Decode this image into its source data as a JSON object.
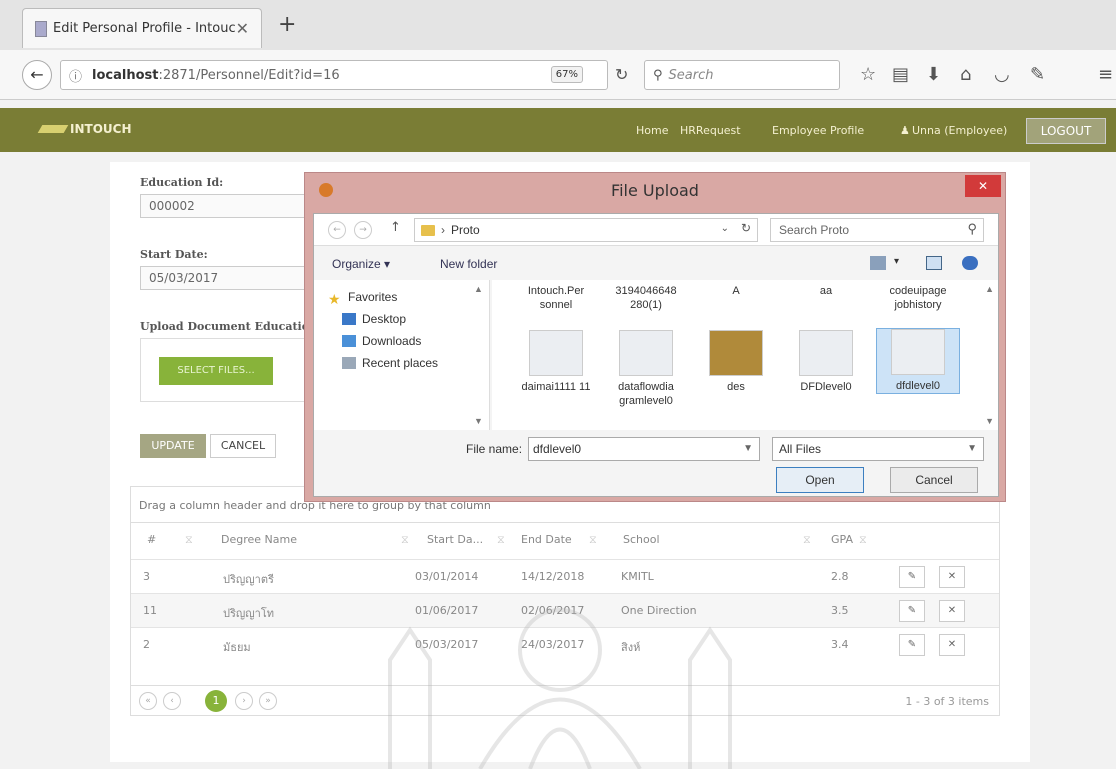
{
  "browser": {
    "tab_title": "Edit Personal Profile - Intouc",
    "tab_close": "✕",
    "new_tab": "+",
    "url_host": "localhost",
    "url_path": ":2871/Personnel/Edit?id=16",
    "zoom": "67%",
    "search_placeholder": "Search"
  },
  "app": {
    "logo": "INTOUCH",
    "nav": [
      "Home",
      "HRRequest",
      "Employee Profile",
      "Unna (Employee)"
    ],
    "logout": "LOGOUT",
    "accent": "#7a7d35"
  },
  "form": {
    "education_id_label": "Education Id:",
    "education_id_value": "000002",
    "start_date_label": "Start Date:",
    "start_date_value": "05/03/2017",
    "upload_label": "Upload Document EducationSc",
    "select_files": "SELECT FILES...",
    "update": "UPDATE",
    "cancel": "CANCEL"
  },
  "grid": {
    "group_hint": "Drag a column header and drop it here to group by that column",
    "columns": [
      "#",
      "Degree Name",
      "Start Da...",
      "End Date",
      "School",
      "GPA"
    ],
    "rows": [
      {
        "id": "3",
        "degree": "ปริญญาตรี",
        "start": "03/01/2014",
        "end": "14/12/2018",
        "school": "KMITL",
        "gpa": "2.8"
      },
      {
        "id": "11",
        "degree": "ปริญญาโท",
        "start": "01/06/2017",
        "end": "02/06/2017",
        "school": "One Direction",
        "gpa": "3.5"
      },
      {
        "id": "2",
        "degree": "มัธยม",
        "start": "05/03/2017",
        "end": "24/03/2017",
        "school": "สิงห์",
        "gpa": "3.4"
      }
    ],
    "page_current": "1",
    "page_info": "1 - 3 of 3 items"
  },
  "dialog": {
    "title": "File Upload",
    "close": "✕",
    "path": "Proto",
    "search_placeholder": "Search Proto",
    "organize": "Organize ▾",
    "new_folder": "New folder",
    "tree": [
      "Favorites",
      "Desktop",
      "Downloads",
      "Recent places"
    ],
    "files_row1": [
      "Intouch.Per sonnel",
      "3194046648 280(1)",
      "A",
      "aa",
      "codeuipage jobhistory"
    ],
    "files_row2": [
      "daimai1111 11",
      "dataflowdia gramlevel0",
      "des",
      "DFDlevel0",
      "dfdlevel0"
    ],
    "file_name_label": "File name:",
    "file_name_value": "dfdlevel0",
    "file_type": "All Files",
    "open": "Open",
    "cancel": "Cancel"
  }
}
